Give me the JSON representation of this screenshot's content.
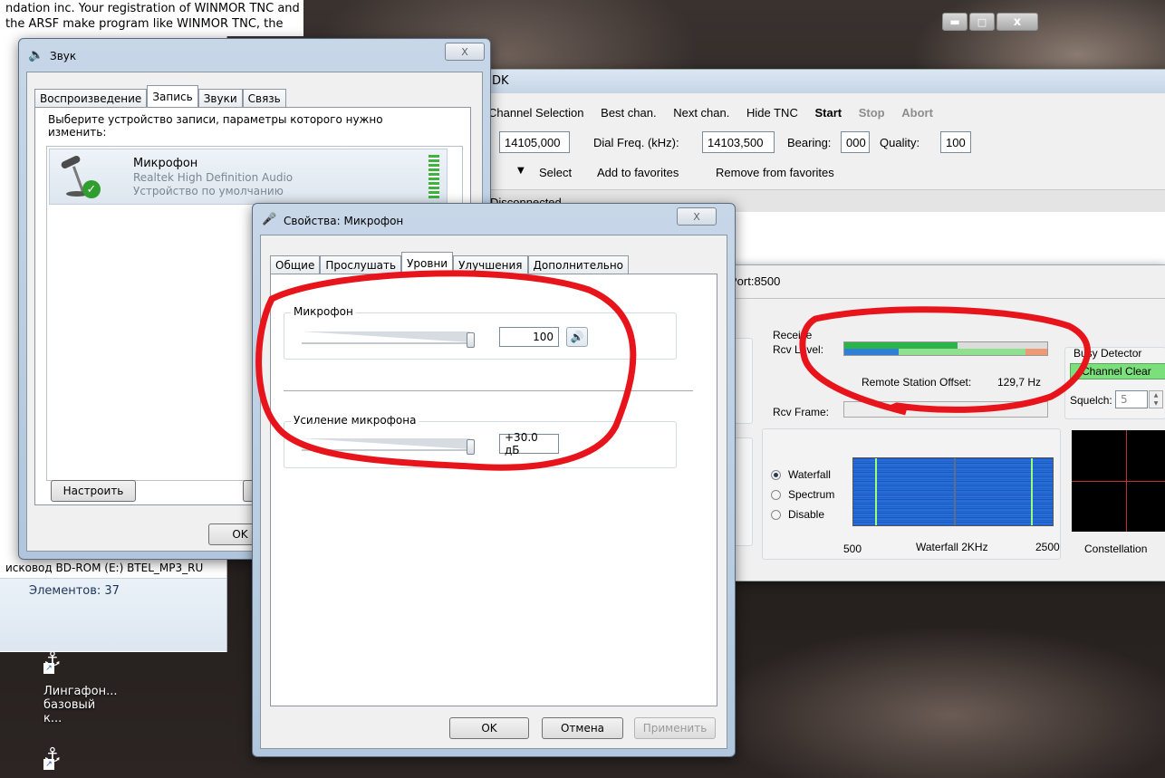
{
  "background_window": {
    "text_line1": "ndation inc.  Your registration of WINMOR TNC and",
    "text_line2": "the ARSF make program like WINMOR TNC, the",
    "explorer_drive": "исковод BD-ROM (E:) BTEL_MP3_RU",
    "explorer_count": "Элементов: 37"
  },
  "desktop": {
    "icon1_label_line1": "Лингафон...",
    "icon1_label_line2": "базовый к..."
  },
  "tnc": {
    "title": "DK",
    "menu": {
      "channel_selection": "Channel Selection",
      "best_chan": "Best chan.",
      "next_chan": "Next chan.",
      "hide_tnc": "Hide TNC",
      "start": "Start",
      "stop": "Stop",
      "abort": "Abort"
    },
    "freq_value": "14105,000",
    "dial_label": "Dial Freq. (kHz):",
    "dial_value": "14103,500",
    "bearing_label": "Bearing:",
    "bearing_value": "000",
    "quality_label": "Quality:",
    "quality_value": "100",
    "select": "Select",
    "add_fav": "Add to favorites",
    "remove_fav": "Remove from favorites",
    "status": "Disconnected",
    "port": "Port:8500",
    "receive_label": "Receive",
    "rcv_level_label": "Rcv Level:",
    "rcv_level_fraction": 0.56,
    "remote_offset_label": "Remote Station Offset:",
    "remote_offset_value": "129,7 Hz",
    "rcv_frame_label": "Rcv Frame:",
    "busy_detector_label": "Busy Detector",
    "busy_state": "Channel Clear",
    "squelch_label": "Squelch:",
    "squelch_value": "5",
    "display_options": [
      "Waterfall",
      "Spectrum",
      "Disable"
    ],
    "waterfall_min": "500",
    "waterfall_title": "Waterfall 2KHz",
    "waterfall_max": "2500",
    "constellation_label": "Constellation"
  },
  "sound_dialog": {
    "title": "Звук",
    "tabs": [
      "Воспроизведение",
      "Запись",
      "Звуки",
      "Связь"
    ],
    "instruction": "Выберите устройство записи, параметры которого нужно изменить:",
    "device_name": "Микрофон",
    "device_driver": "Realtek High Definition Audio",
    "device_status": "Устройство по умолчанию",
    "configure_button": "Настроить",
    "ok_button": "OK"
  },
  "mic_props": {
    "title": "Свойства: Микрофон",
    "tabs": [
      "Общие",
      "Прослушать",
      "Уровни",
      "Улучшения",
      "Дополнительно"
    ],
    "mic_group": "Микрофон",
    "mic_value": "100",
    "boost_group": "Усиление микрофона",
    "boost_value": "+30.0 дБ",
    "ok": "OK",
    "cancel": "Отмена",
    "apply": "Применить"
  },
  "colors": {
    "annotation": "#e8141c",
    "busy_green": "#7be07b",
    "level_green": "#2cb34a",
    "level_blue": "#2f7fd6"
  }
}
